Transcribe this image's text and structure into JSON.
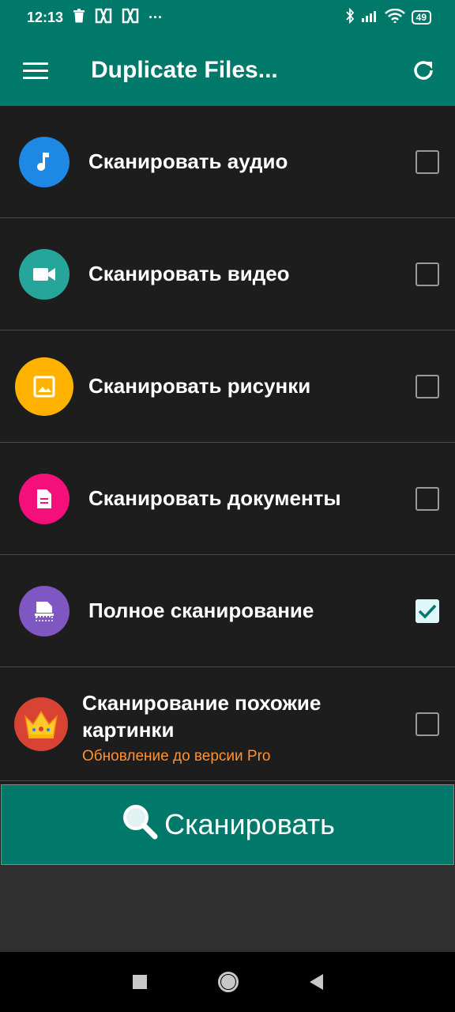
{
  "status_bar": {
    "time": "12:13",
    "notification_icons": [
      "trash-icon",
      "app-icon",
      "app-icon"
    ],
    "more": "···",
    "battery": "49"
  },
  "app_bar": {
    "title": "Duplicate Files...",
    "menu_icon": "menu-icon",
    "refresh_icon": "refresh-icon"
  },
  "options": [
    {
      "label": "Сканировать аудио",
      "icon": "music-note-icon",
      "color": "#1e88e5",
      "checked": false
    },
    {
      "label": "Сканировать видео",
      "icon": "video-camera-icon",
      "color": "#26a69a",
      "checked": false
    },
    {
      "label": "Сканировать рисунки",
      "icon": "image-icon",
      "color": "#ffb300",
      "checked": false
    },
    {
      "label": "Сканировать документы",
      "icon": "document-icon",
      "color": "#f50f7a",
      "checked": false
    },
    {
      "label": "Полное сканирование",
      "icon": "scanner-icon",
      "color": "#7e57c2",
      "checked": true
    }
  ],
  "pro_option": {
    "label": "Сканирование похожие картинки",
    "sub_label": "Обновление до версии Pro",
    "icon": "crown-icon",
    "checked": false
  },
  "scan_button": {
    "label": "Сканировать",
    "icon": "search-icon"
  },
  "colors": {
    "accent": "#00796b",
    "background": "#1d1d1d",
    "pro_text": "#ff9233"
  }
}
